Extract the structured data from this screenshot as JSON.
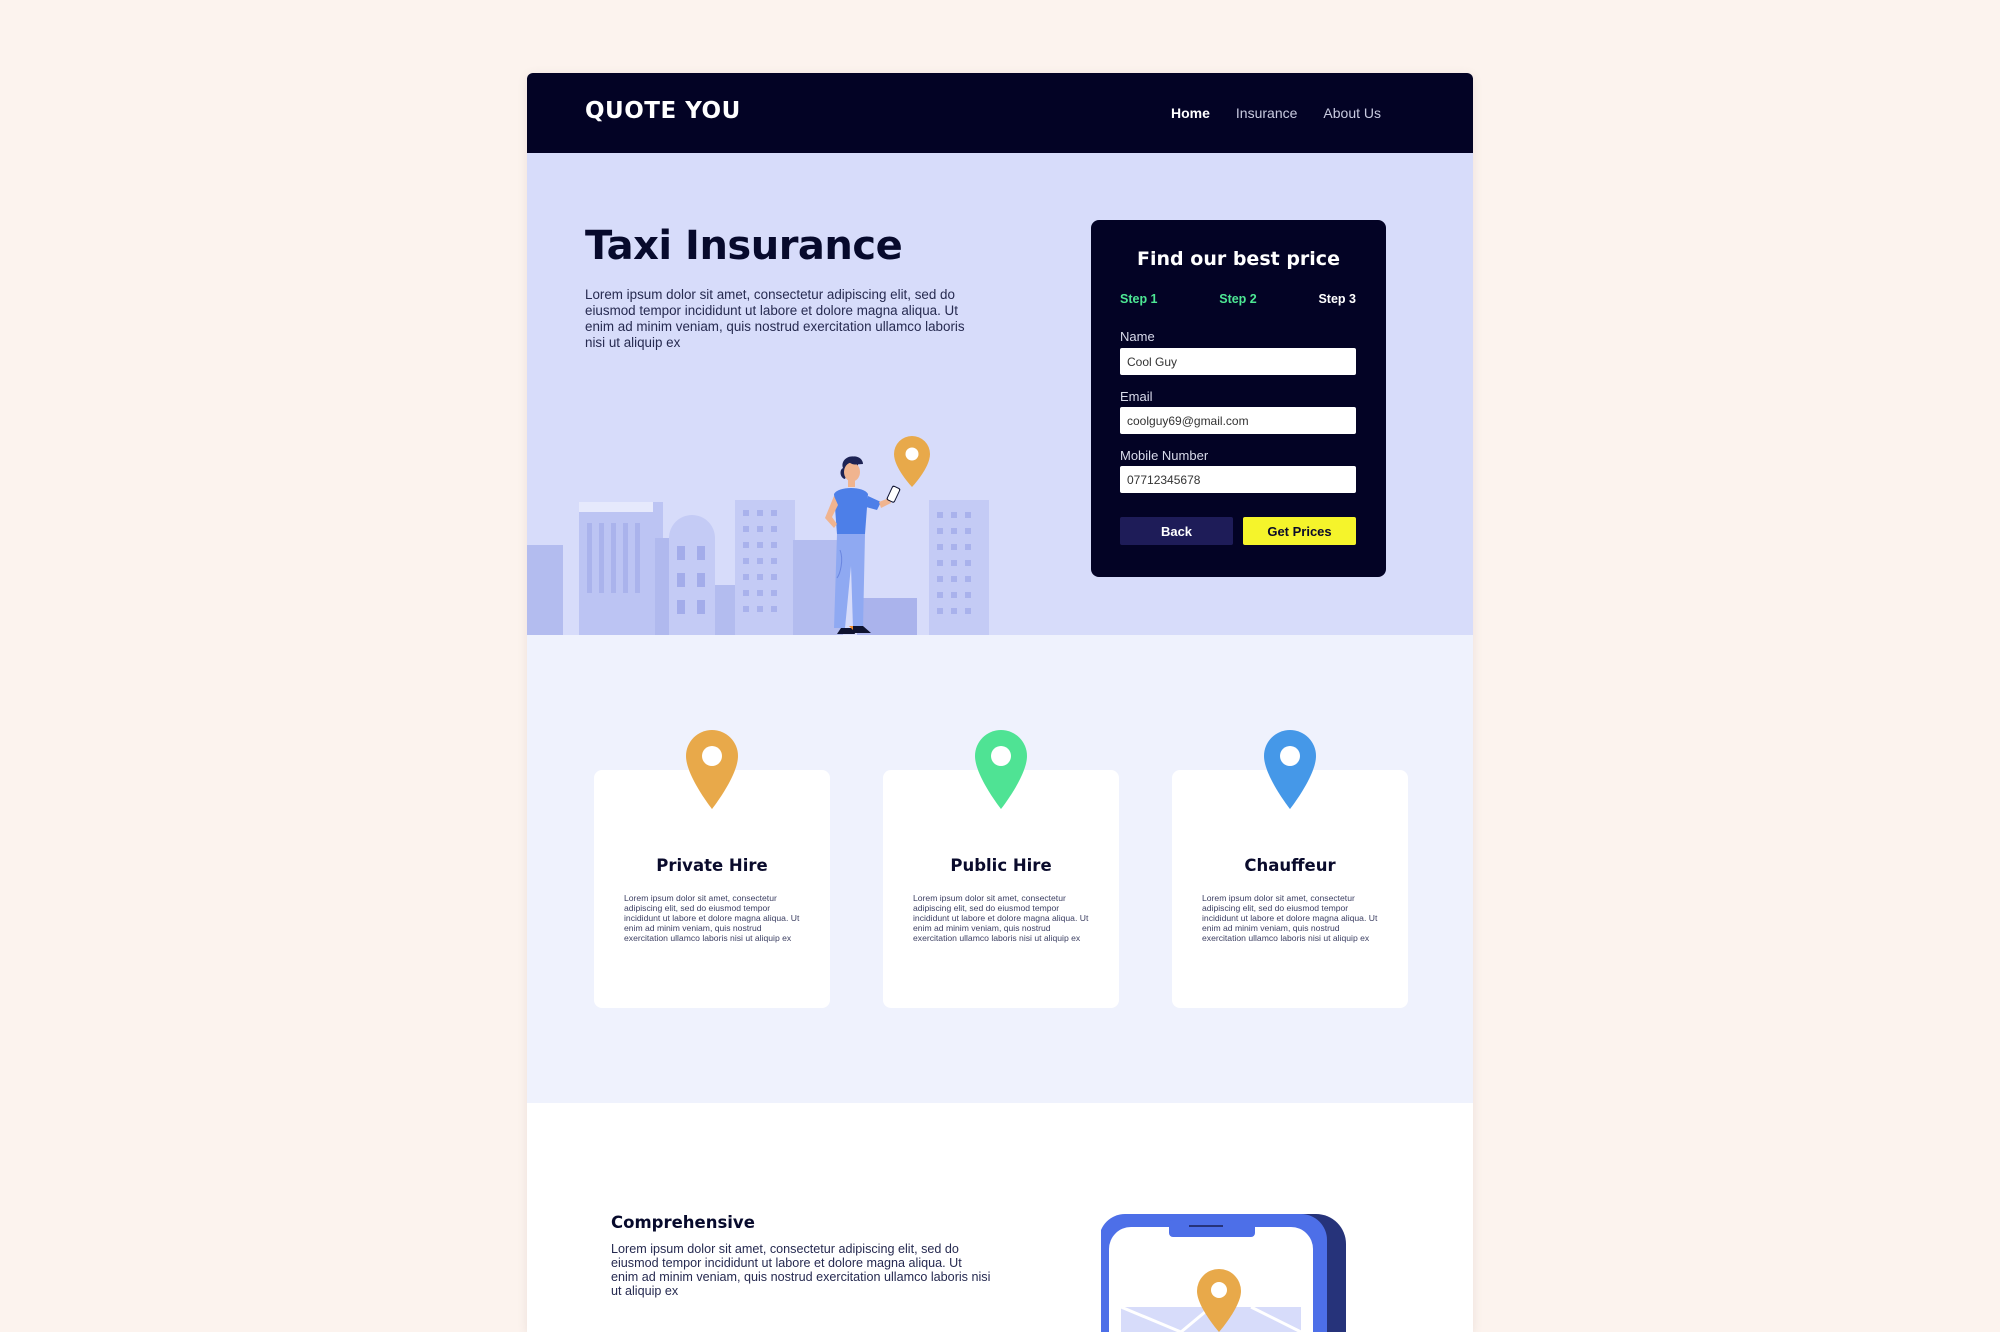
{
  "nav": {
    "logo": "QUOTE YOU",
    "links": [
      {
        "label": "Home",
        "active": true
      },
      {
        "label": "Insurance",
        "active": false
      },
      {
        "label": "About Us",
        "active": false
      }
    ]
  },
  "hero": {
    "title": "Taxi Insurance",
    "text": "Lorem ipsum dolor sit amet, consectetur adipiscing elit, sed do eiusmod tempor incididunt ut labore et dolore magna aliqua. Ut enim ad minim veniam, quis nostrud exercitation ullamco laboris nisi ut aliquip ex"
  },
  "form": {
    "title": "Find our best price",
    "steps": [
      {
        "label": "Step 1",
        "state": "done"
      },
      {
        "label": "Step 2",
        "state": "done"
      },
      {
        "label": "Step 3",
        "state": "current"
      }
    ],
    "fields": {
      "name": {
        "label": "Name",
        "value": "Cool Guy"
      },
      "email": {
        "label": "Email",
        "value": "coolguy69@gmail.com"
      },
      "mobile": {
        "label": "Mobile Number",
        "value": "07712345678"
      }
    },
    "back_label": "Back",
    "submit_label": "Get Prices"
  },
  "features": [
    {
      "title": "Private Hire",
      "pin_color": "#e8a94a",
      "text": "Lorem ipsum dolor sit amet, consectetur adipiscing elit, sed do eiusmod tempor incididunt ut labore et dolore magna aliqua. Ut enim ad minim veniam, quis nostrud exercitation ullamco laboris nisi ut aliquip ex"
    },
    {
      "title": "Public Hire",
      "pin_color": "#4fe394",
      "text": "Lorem ipsum dolor sit amet, consectetur adipiscing elit, sed do eiusmod tempor incididunt ut labore et dolore magna aliqua. Ut enim ad minim veniam, quis nostrud exercitation ullamco laboris nisi ut aliquip ex"
    },
    {
      "title": "Chauffeur",
      "pin_color": "#4598e8",
      "text": "Lorem ipsum dolor sit amet, consectetur adipiscing elit, sed do eiusmod tempor incididunt ut labore et dolore magna aliqua. Ut enim ad minim veniam, quis nostrud exercitation ullamco laboris nisi ut aliquip ex"
    }
  ],
  "comprehensive": {
    "title": "Comprehensive",
    "text": "Lorem ipsum dolor sit amet, consectetur adipiscing elit, sed do eiusmod tempor incididunt ut labore et dolore magna aliqua. Ut enim ad minim veniam, quis nostrud exercitation ullamco laboris nisi ut aliquip ex"
  },
  "colors": {
    "nav_bg": "#030325",
    "hero_bg": "#d7dcfa",
    "features_bg": "#eff2fd",
    "step_done": "#4de794",
    "cta_yellow": "#f5f42b",
    "pin_orange": "#e8a94a"
  }
}
